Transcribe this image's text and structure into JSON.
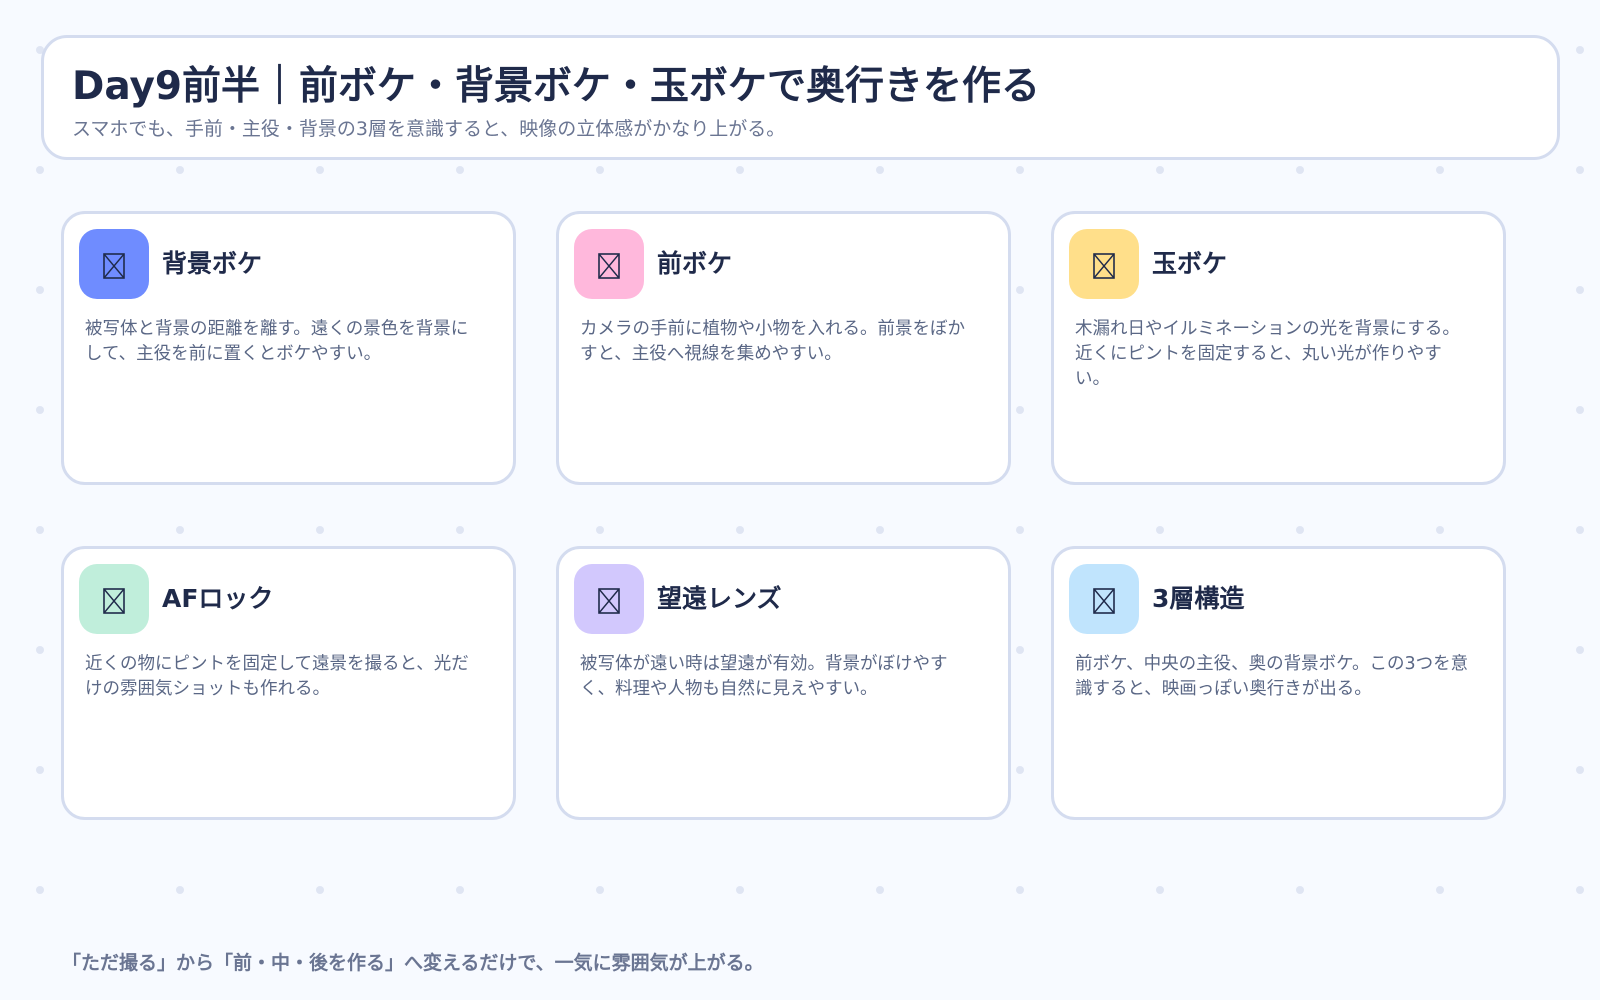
{
  "header": {
    "title": "Day9前半｜前ボケ・背景ボケ・玉ボケで奥行きを作る",
    "subtitle": "スマホでも、手前・主役・背景の3層を意識すると、映像の立体感がかなり上がる。"
  },
  "cards": [
    {
      "title": "背景ボケ",
      "body": "被写体と背景の距離を離す。遠くの景色を背景にして、主役を前に置くとボケやすい。",
      "icon": "image-placeholder-icon",
      "color": "#6f8cff"
    },
    {
      "title": "前ボケ",
      "body": "カメラの手前に植物や小物を入れる。前景をぼかすと、主役へ視線を集めやすい。",
      "icon": "image-placeholder-icon",
      "color": "#ffb8dc"
    },
    {
      "title": "玉ボケ",
      "body": "木漏れ日やイルミネーションの光を背景にする。近くにピントを固定すると、丸い光が作りやすい。",
      "icon": "image-placeholder-icon",
      "color": "#ffdf8a"
    },
    {
      "title": "AFロック",
      "body": "近くの物にピントを固定して遠景を撮ると、光だけの雰囲気ショットも作れる。",
      "icon": "image-placeholder-icon",
      "color": "#c0eedb"
    },
    {
      "title": "望遠レンズ",
      "body": "被写体が遠い時は望遠が有効。背景がぼけやすく、料理や人物も自然に見えやすい。",
      "icon": "image-placeholder-icon",
      "color": "#d2c8fd"
    },
    {
      "title": "3層構造",
      "body": "前ボケ、中央の主役、奥の背景ボケ。この3つを意識すると、映画っぽい奥行きが出る。",
      "icon": "image-placeholder-icon",
      "color": "#c0e4fd"
    }
  ],
  "footer": {
    "text": "「ただ撮る」から「前・中・後を作る」へ変えるだけで、一気に雰囲気が上がる。"
  }
}
